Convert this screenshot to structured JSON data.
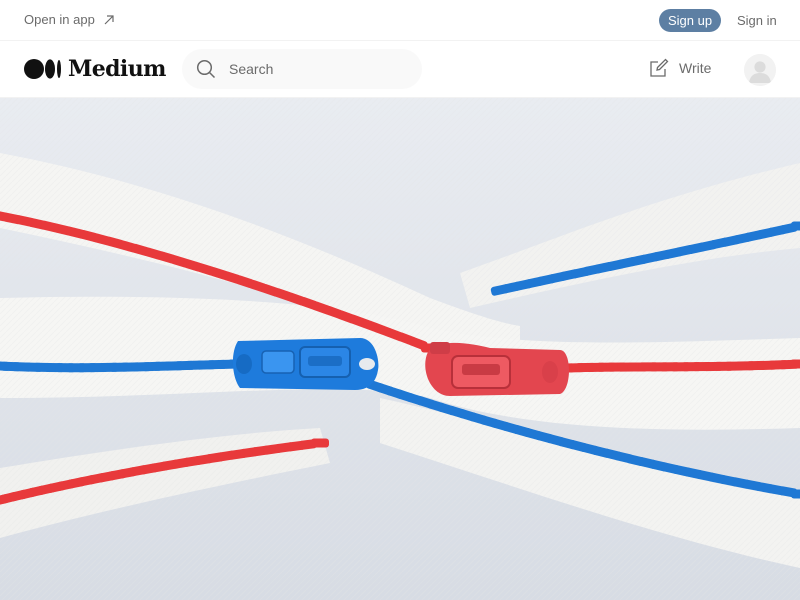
{
  "banner": {
    "open_in_app": "Open in app",
    "sign_up": "Sign up",
    "sign_in": "Sign in"
  },
  "header": {
    "logo_text": "Medium",
    "search_placeholder": "Search",
    "write_label": "Write"
  },
  "hero": {
    "icon": "zipper-photo",
    "colors": {
      "background": "#dfe3e9",
      "tape": "#f4f4f2",
      "red_teeth": "#e8393b",
      "blue_teeth": "#1f78d4"
    }
  },
  "colors": {
    "signup_button": "#5d7fa3",
    "muted_text": "#6b6b6b"
  }
}
